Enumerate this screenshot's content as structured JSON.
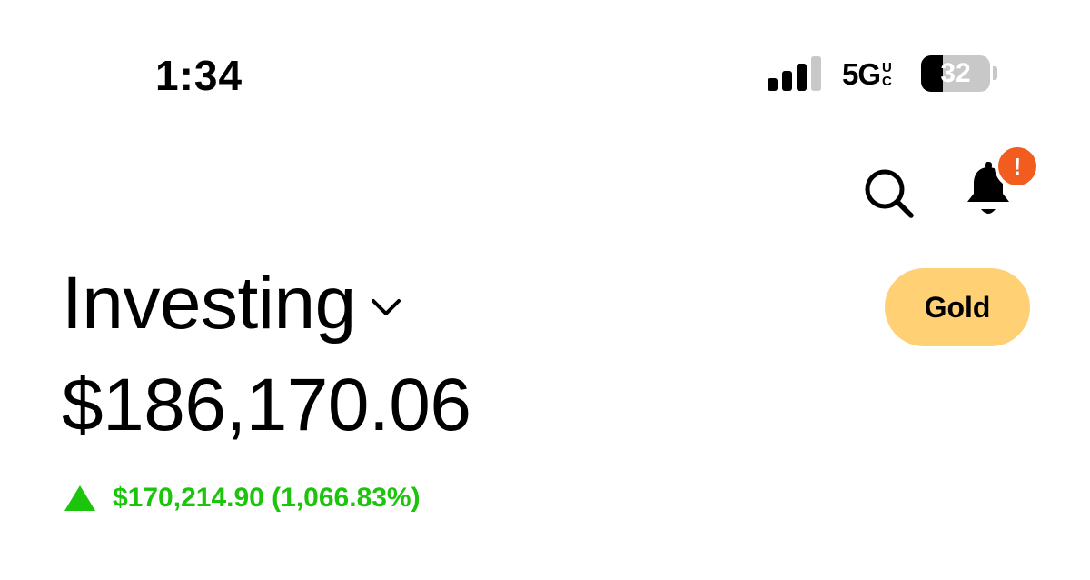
{
  "status_bar": {
    "time": "1:34",
    "network_main": "5G",
    "network_sub_top": "U",
    "network_sub_bottom": "C",
    "battery_level": "32",
    "signal_strength_bars": 3,
    "signal_total_bars": 4
  },
  "header": {
    "search_icon": "search-icon",
    "bell_icon": "bell-icon",
    "notification_badge": "!"
  },
  "account": {
    "title": "Investing",
    "dropdown_icon": "chevron-down-icon",
    "value": "$186,170.06",
    "change": "$170,214.90 (1,066.83%)",
    "change_direction_icon": "triangle-up-icon"
  },
  "gold_button": {
    "label": "Gold"
  },
  "colors": {
    "positive": "#1cc40b",
    "gold": "#ffd074",
    "badge": "#f25c1f",
    "text": "#000000",
    "background": "#ffffff"
  }
}
